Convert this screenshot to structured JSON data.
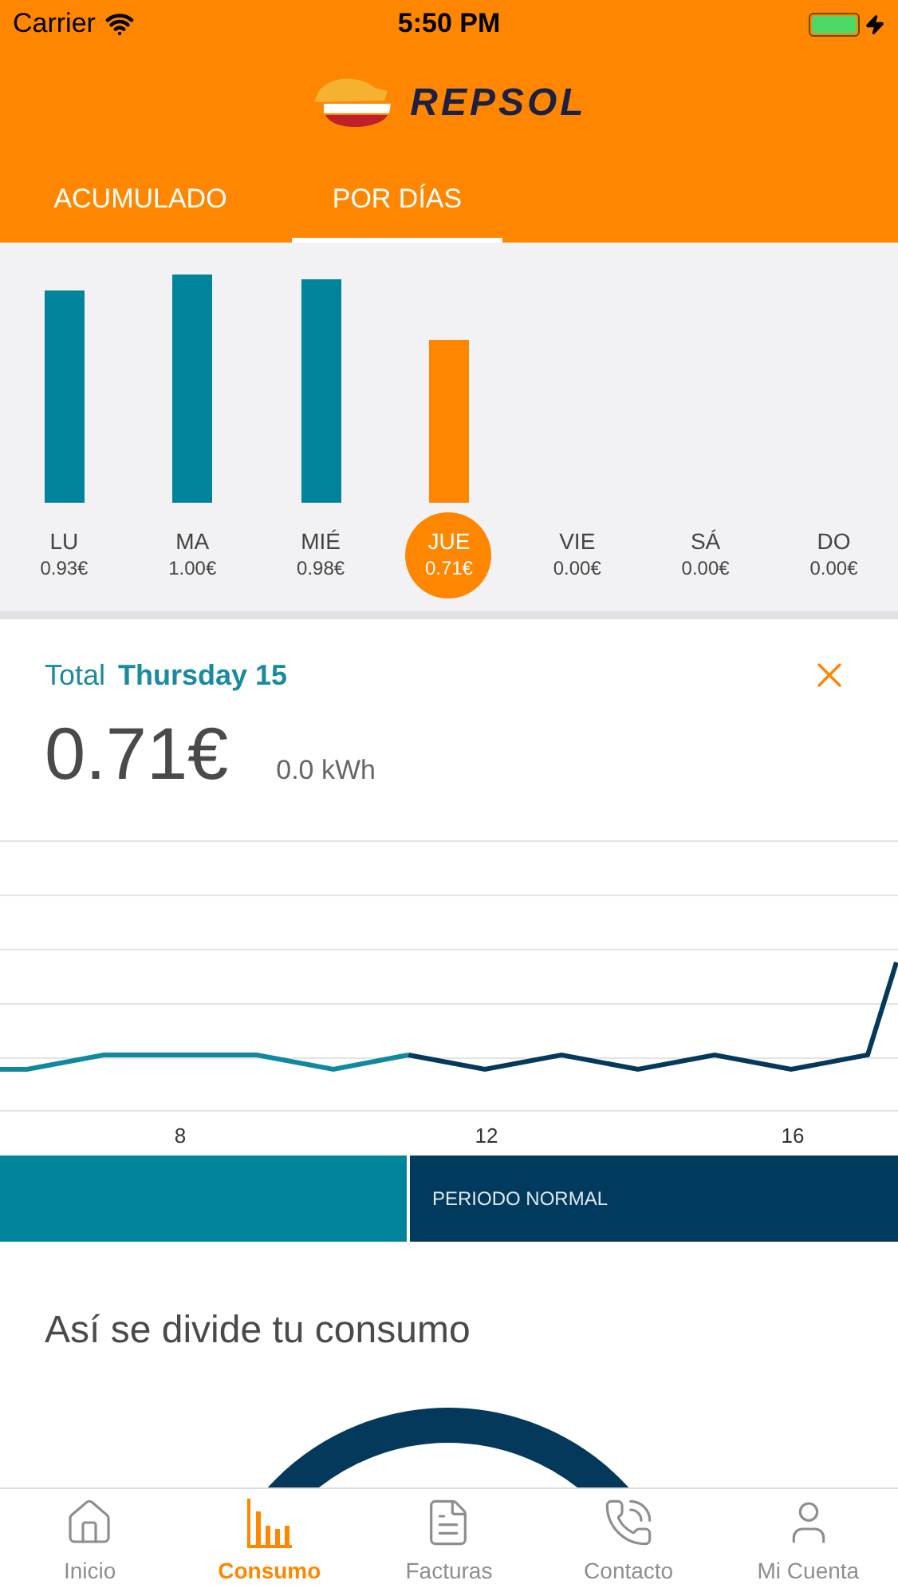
{
  "status_bar": {
    "carrier": "Carrier",
    "time": "5:50 PM"
  },
  "header": {
    "brand": "REPSOL"
  },
  "tabs": [
    {
      "label": "ACUMULADO",
      "selected": false
    },
    {
      "label": "POR DÍAS",
      "selected": true
    }
  ],
  "days": [
    {
      "label": "LU",
      "amount": "0.93€",
      "level": 0.93,
      "selected": false
    },
    {
      "label": "MA",
      "amount": "1.00€",
      "level": 1.0,
      "selected": false
    },
    {
      "label": "MIÉ",
      "amount": "0.98€",
      "level": 0.98,
      "selected": false
    },
    {
      "label": "JUE",
      "amount": "0.71€",
      "level": 0.71,
      "selected": true
    },
    {
      "label": "VIE",
      "amount": "0.00€",
      "selected": false
    },
    {
      "label": "SÁ",
      "amount": "0.00€",
      "selected": false
    },
    {
      "label": "DO",
      "amount": "0.00€",
      "selected": false
    }
  ],
  "detail": {
    "total_label": "Total",
    "date": "Thursday 15",
    "amount": "0.71€",
    "energy": "0.0 kWh"
  },
  "hourly_chart": {
    "x_labels": [
      "8",
      "12",
      "16"
    ]
  },
  "periods": [
    {
      "color": "#00849c"
    },
    {
      "label": "PERIODO NORMAL",
      "color": "#003a5c"
    }
  ],
  "breakdown": {
    "title": "Así se divide tu consumo"
  },
  "nav": [
    {
      "label": "Inicio",
      "selected": false
    },
    {
      "label": "Consumo",
      "selected": true
    },
    {
      "label": "Facturas",
      "selected": false
    },
    {
      "label": "Contacto",
      "selected": false
    },
    {
      "label": "Mi Cuenta",
      "selected": false
    }
  ]
}
